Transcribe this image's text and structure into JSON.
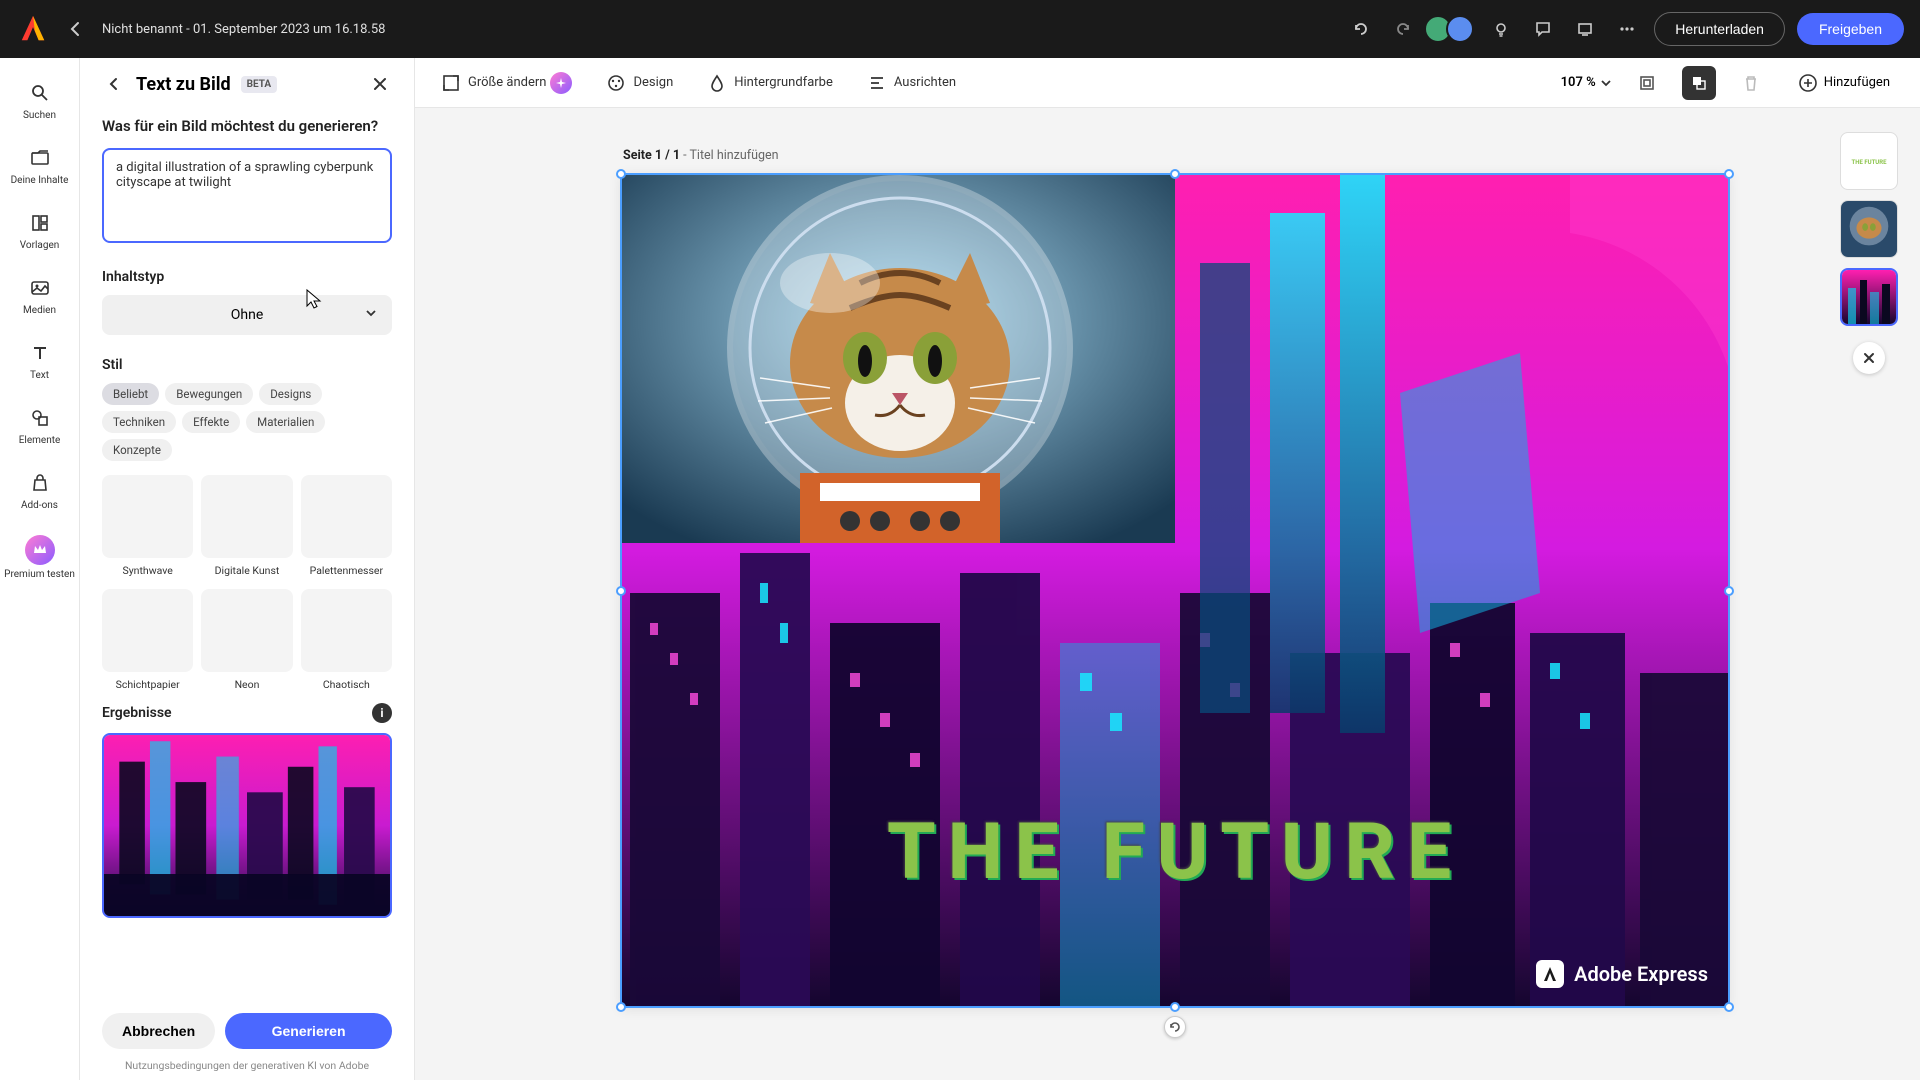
{
  "header": {
    "doc_title": "Nicht benannt - 01. September 2023 um 16.18.58",
    "download": "Herunterladen",
    "share": "Freigeben"
  },
  "rail": {
    "search": "Suchen",
    "your_content": "Deine Inhalte",
    "templates": "Vorlagen",
    "media": "Medien",
    "text": "Text",
    "elements": "Elemente",
    "addons": "Add-ons",
    "premium": "Premium testen"
  },
  "panel": {
    "title": "Text zu Bild",
    "beta": "BETA",
    "prompt_label": "Was für ein Bild möchtest du generieren?",
    "prompt_value": "a digital illustration of a sprawling cyberpunk cityscape at twilight",
    "content_type_label": "Inhaltstyp",
    "content_type_value": "Ohne",
    "style_label": "Stil",
    "style_chips": [
      "Beliebt",
      "Bewegungen",
      "Designs",
      "Techniken",
      "Effekte",
      "Materialien",
      "Konzepte"
    ],
    "styles_row1": [
      "Synthwave",
      "Digitale Kunst",
      "Palettenmesser"
    ],
    "styles_row2": [
      "Schichtpapier",
      "Neon",
      "Chaotisch"
    ],
    "results_label": "Ergebnisse",
    "cancel": "Abbrechen",
    "generate": "Generieren",
    "terms": "Nutzungsbedingungen der generativen KI von Adobe"
  },
  "toolbar": {
    "resize": "Größe ändern",
    "design": "Design",
    "background": "Hintergrundfarbe",
    "align": "Ausrichten",
    "zoom": "107 %",
    "add": "Hinzufügen"
  },
  "canvas": {
    "page_indicator_bold": "Seite 1 / 1",
    "page_indicator_rest": " - Titel hinzufügen",
    "hero_text": "THE FUTURE",
    "watermark": "Adobe Express"
  },
  "colors": {
    "accent": "#4b68ff",
    "magenta": "#e61bd0",
    "cyan": "#18d4ff"
  }
}
